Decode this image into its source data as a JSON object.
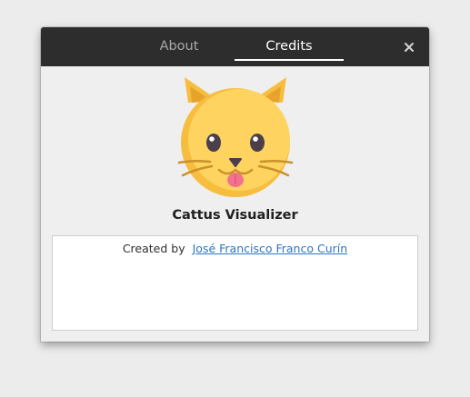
{
  "dialog": {
    "tabs": [
      {
        "label": "About",
        "active": false
      },
      {
        "label": "Credits",
        "active": true
      }
    ]
  },
  "app": {
    "name": "Cattus Visualizer",
    "logo_icon": "cat-face-icon"
  },
  "credits": {
    "label": "Created by",
    "author": "José Francisco Franco Curín"
  },
  "colors": {
    "header_bg": "#2d2d2d",
    "link": "#2a76c6",
    "cat_face": "#ffd35f",
    "cat_ears": "#f6bd3f"
  }
}
